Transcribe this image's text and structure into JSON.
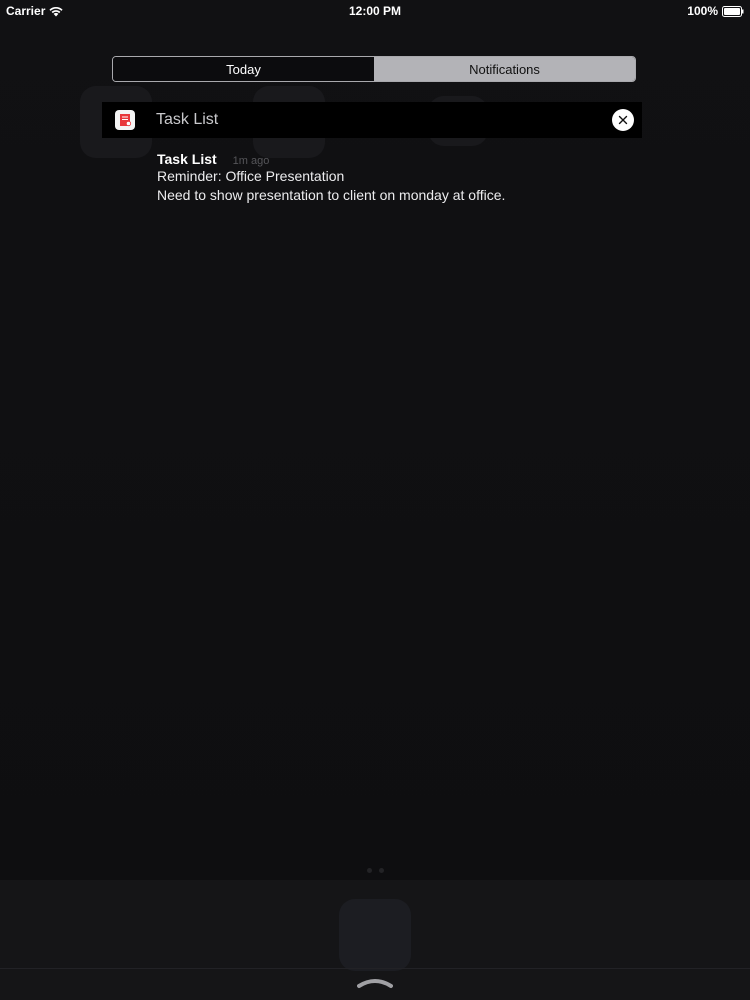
{
  "status_bar": {
    "carrier": "Carrier",
    "time": "12:00 PM",
    "battery": "100%"
  },
  "segmented_control": {
    "tabs": [
      {
        "label": "Today",
        "selected": true
      },
      {
        "label": "Notifications",
        "selected": false
      }
    ]
  },
  "notification_group": {
    "app_name": "Task List",
    "app_icon": "task-list-app-icon",
    "clear_icon": "close-icon"
  },
  "notification": {
    "title": "Task List",
    "time": "1m ago",
    "lines": [
      "Reminder: Office Presentation",
      "Need to show presentation to client on monday at office."
    ]
  },
  "colors": {
    "background": "#0d0d0f",
    "segment_selected_bg": "#0c0c0e",
    "segment_unselected_bg": "#b3b3b7",
    "app_icon_accent": "#e8373b"
  }
}
